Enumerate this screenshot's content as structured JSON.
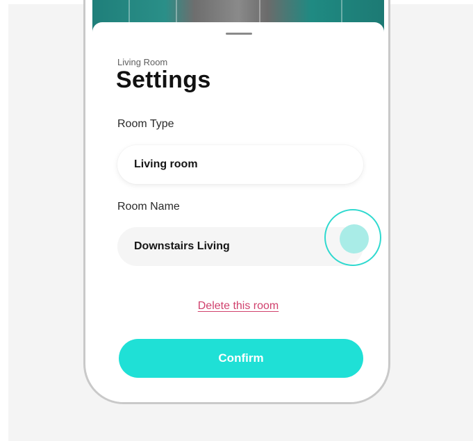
{
  "sheet": {
    "subtitle": "Living Room",
    "title": "Settings"
  },
  "room_type": {
    "label": "Room Type",
    "value": "Living room"
  },
  "room_name": {
    "label": "Room Name",
    "value": "Downstairs Living"
  },
  "actions": {
    "delete_label": "Delete this room",
    "confirm_label": "Confirm"
  },
  "colors": {
    "accent": "#1fe0d6",
    "danger_link": "#d0416d",
    "touch_indicator": "#2fd9cf"
  }
}
